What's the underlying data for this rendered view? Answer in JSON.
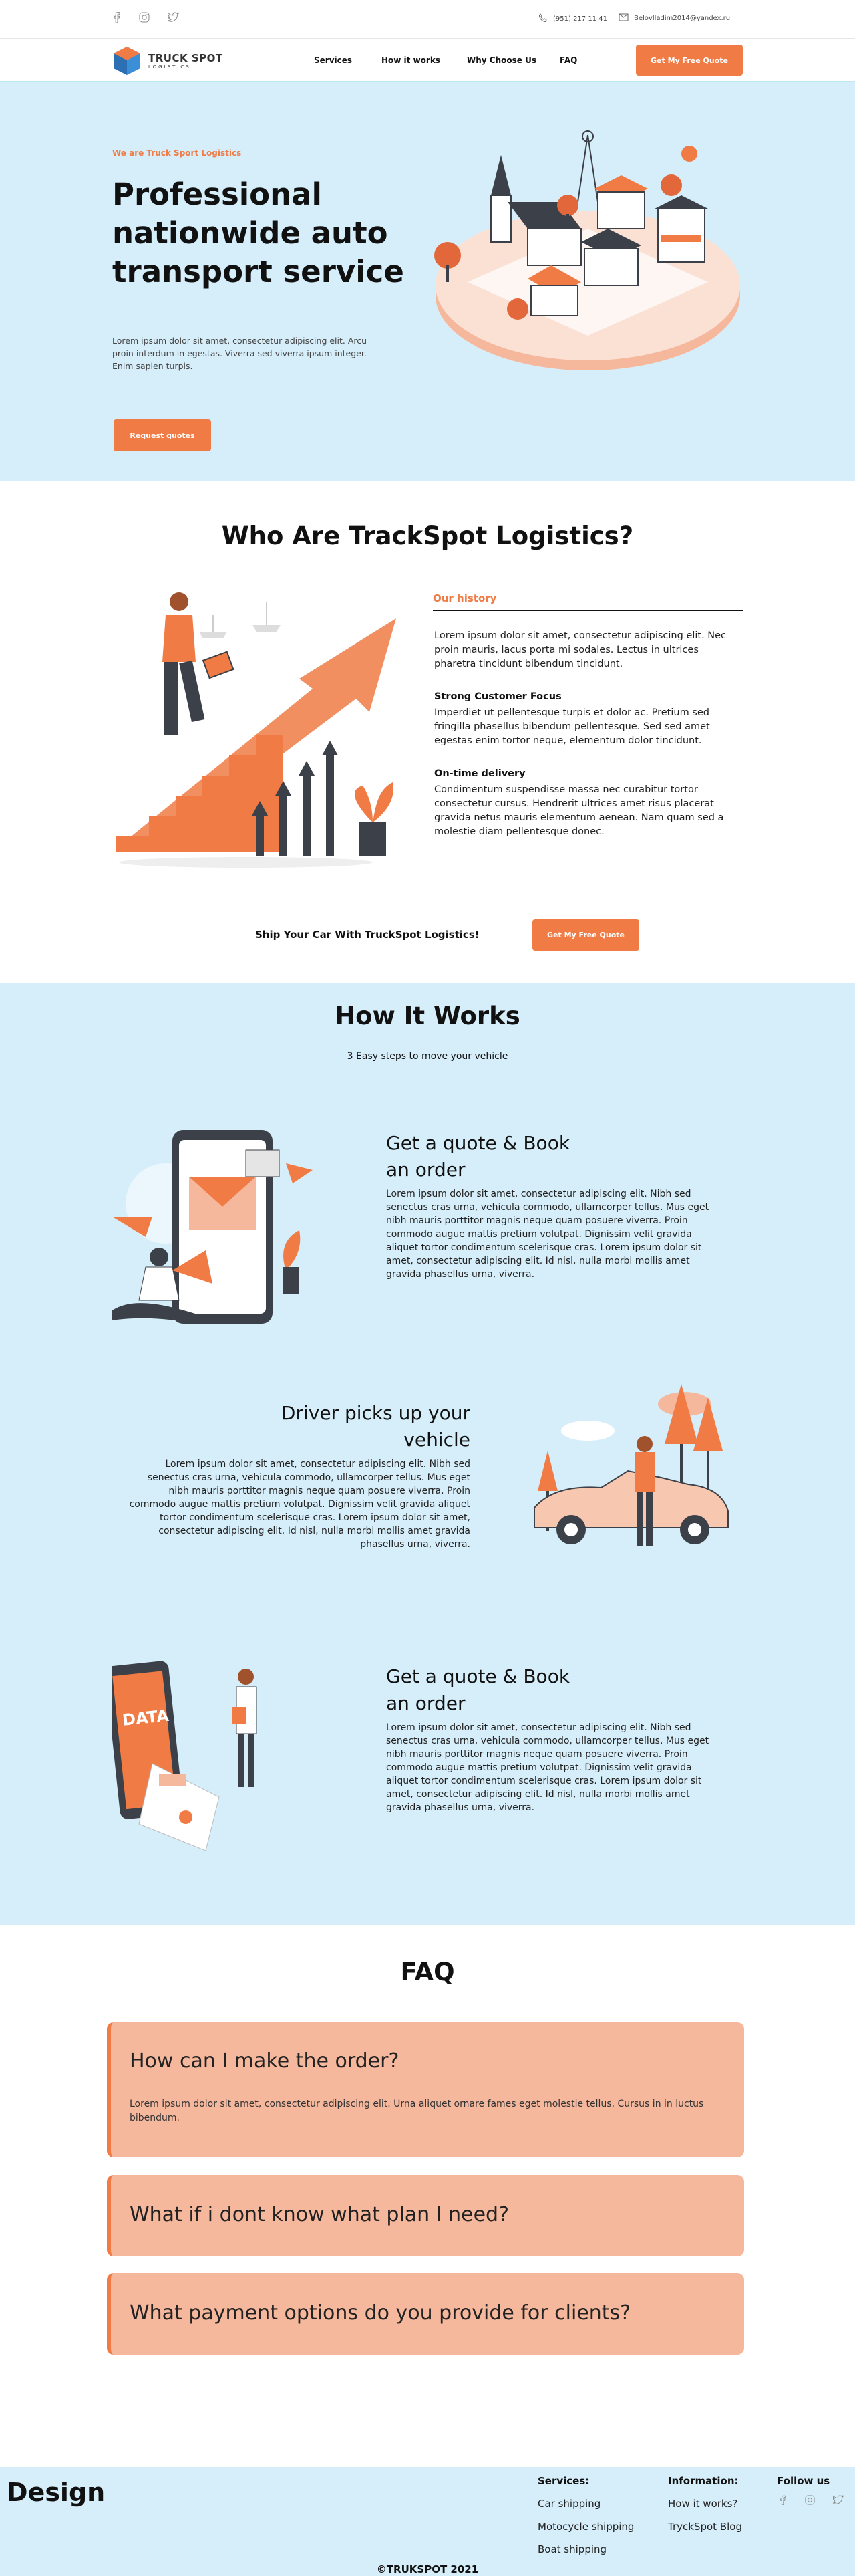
{
  "topbar": {
    "socials": [
      "facebook-icon",
      "instagram-icon",
      "twitter-icon"
    ],
    "phone": "(951) 217 11 41",
    "email": "Belovlladim2014@yandex.ru"
  },
  "nav": {
    "logo_main": "TRUCK SPOT",
    "logo_sub": "LOGISTICS",
    "links": [
      "Services",
      "How it works",
      "Why Choose Us",
      "FAQ"
    ],
    "cta": "Get My Free Quote"
  },
  "hero": {
    "eyebrow": "We are Truck Sport Logistics",
    "title": "Professional nationwide auto transport service",
    "subtitle": "Lorem ipsum dolor sit amet, consectetur adipiscing elit. Arcu proin interdum in egestas. Viverra sed viverra ipsum integer. Enim sapien turpis.",
    "button": "Request quotes"
  },
  "who": {
    "title": "Who Are TrackSpot Logistics?",
    "history_label": "Our history",
    "history_text": "Lorem ipsum dolor sit amet, consectetur adipiscing elit. Nec proin mauris, lacus porta mi sodales. Lectus in ultrices pharetra tincidunt bibendum tincidunt.",
    "focus_title": "Strong Customer Focus",
    "focus_text": "Imperdiet ut pellentesque turpis et dolor ac. Pretium sed fringilla phasellus bibendum pellentesque. Sed sed amet egestas enim tortor neque, elementum dolor tincidunt.",
    "delivery_title": "On-time delivery",
    "delivery_text": "Condimentum suspendisse massa nec curabitur tortor consectetur cursus. Hendrerit ultrices amet risus placerat gravida netus mauris elementum aenean. Nam quam sed a molestie diam pellentesque donec.",
    "ship_text": "Ship Your Car With TruckSpot Logistics!",
    "ship_button": "Get My Free Quote"
  },
  "how": {
    "title": "How It Works",
    "subtitle": "3 Easy steps to move your vehicle",
    "steps": [
      {
        "title": "Get a quote & Book an order",
        "body": "Lorem ipsum dolor sit amet, consectetur adipiscing elit. Nibh sed senectus cras urna, vehicula commodo, ullamcorper tellus. Mus eget nibh mauris porttitor magnis neque quam posuere viverra. Proin commodo augue mattis pretium volutpat. Dignissim velit gravida aliquet tortor condimentum scelerisque cras. Lorem ipsum dolor sit amet, consectetur adipiscing elit. Id nisl, nulla morbi mollis amet gravida phasellus urna, viverra."
      },
      {
        "title": "Driver picks up your vehicle",
        "body": "Lorem ipsum dolor sit amet, consectetur adipiscing elit. Nibh sed senectus cras urna, vehicula commodo, ullamcorper tellus. Mus eget nibh mauris porttitor magnis neque quam posuere viverra. Proin commodo augue mattis pretium volutpat. Dignissim velit gravida aliquet tortor condimentum scelerisque cras. Lorem ipsum dolor sit amet, consectetur adipiscing elit. Id nisl, nulla morbi mollis amet gravida phasellus urna, viverra."
      },
      {
        "title": "Get a quote & Book an order",
        "body": "Lorem ipsum dolor sit amet, consectetur adipiscing elit. Nibh sed senectus cras urna, vehicula commodo, ullamcorper tellus. Mus eget nibh mauris porttitor magnis neque quam posuere viverra. Proin commodo augue mattis pretium volutpat. Dignissim velit gravida aliquet tortor condimentum scelerisque cras. Lorem ipsum dolor sit amet, consectetur adipiscing elit. Id nisl, nulla morbi mollis amet gravida phasellus urna, viverra."
      }
    ],
    "data_label": "DATA"
  },
  "faq": {
    "title": "FAQ",
    "items": [
      {
        "q": "How can I make the order?",
        "a": "Lorem ipsum dolor sit amet, consectetur adipiscing elit. Urna aliquet ornare fames eget molestie tellus. Cursus in in luctus bibendum."
      },
      {
        "q": "What if i dont know what plan I need?",
        "a": ""
      },
      {
        "q": "What payment options do you provide for clients?",
        "a": ""
      }
    ]
  },
  "footer": {
    "brand": "Design",
    "services_title": "Services:",
    "services": [
      "Car shipping",
      "Motocycle shipping",
      "Boat shipping"
    ],
    "info_title": "Information:",
    "info": [
      "How it works?",
      "TryckSpot Blog"
    ],
    "follow_title": "Follow  us",
    "copyright": "©TRUKSPOT 2021"
  },
  "colors": {
    "accent": "#f07b45",
    "sky": "#d6eefa",
    "faq_bg": "#f6b89d"
  }
}
